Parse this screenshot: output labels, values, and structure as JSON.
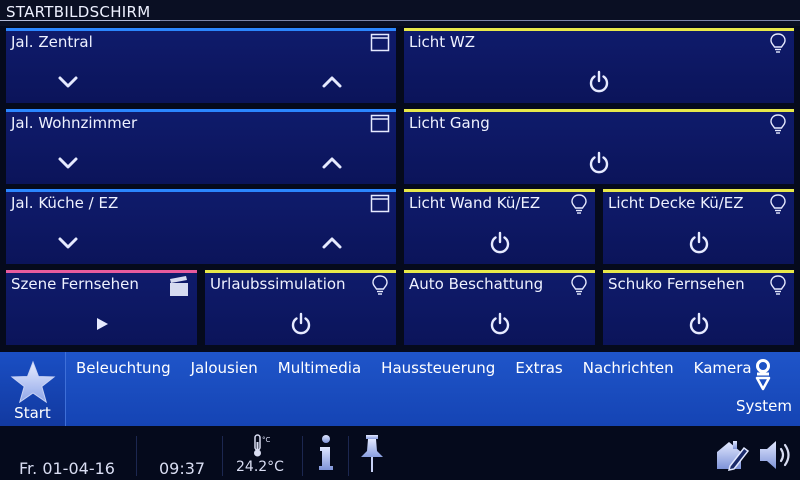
{
  "header": {
    "title": "STARTBILDSCHIRM"
  },
  "tiles": [
    {
      "label": "Jal. Zentral",
      "icon": "blind-icon",
      "color": "#2b86ff",
      "type": "blind"
    },
    {
      "label": "Jal. Wohnzimmer",
      "icon": "blind-icon",
      "color": "#2b86ff",
      "type": "blind"
    },
    {
      "label": "Jal. Küche / EZ",
      "icon": "blind-icon",
      "color": "#2b86ff",
      "type": "blind"
    },
    {
      "label": "Licht WZ",
      "icon": "bulb-icon",
      "color": "#e8e84a",
      "type": "switch"
    },
    {
      "label": "Licht Gang",
      "icon": "bulb-icon",
      "color": "#e8e84a",
      "type": "switch"
    },
    {
      "label": "Licht Wand Kü/EZ",
      "icon": "bulb-icon",
      "color": "#e8e84a",
      "type": "switch"
    },
    {
      "label": "Licht Decke Kü/EZ",
      "icon": "bulb-icon",
      "color": "#e8e84a",
      "type": "switch"
    },
    {
      "label": "Szene Fernsehen",
      "icon": "clapperboard-icon",
      "color": "#e85b9e",
      "type": "scene"
    },
    {
      "label": "Urlaubssimulation",
      "icon": "bulb-icon",
      "color": "#e8e84a",
      "type": "switch"
    },
    {
      "label": "Auto Beschattung",
      "icon": "bulb-icon",
      "color": "#e8e84a",
      "type": "switch"
    },
    {
      "label": "Schuko Fernsehen",
      "icon": "bulb-icon",
      "color": "#e8e84a",
      "type": "switch"
    }
  ],
  "nav": {
    "start_label": "Start",
    "items": [
      "Beleuchtung",
      "Jalousien",
      "Multimedia",
      "Haussteuerung",
      "Extras",
      "Nachrichten",
      "Kamera"
    ],
    "system_label": "System"
  },
  "status": {
    "date": "Fr. 01-04-16",
    "time": "09:37",
    "temperature": "24.2°C",
    "temp_icon_unit": "°C"
  }
}
